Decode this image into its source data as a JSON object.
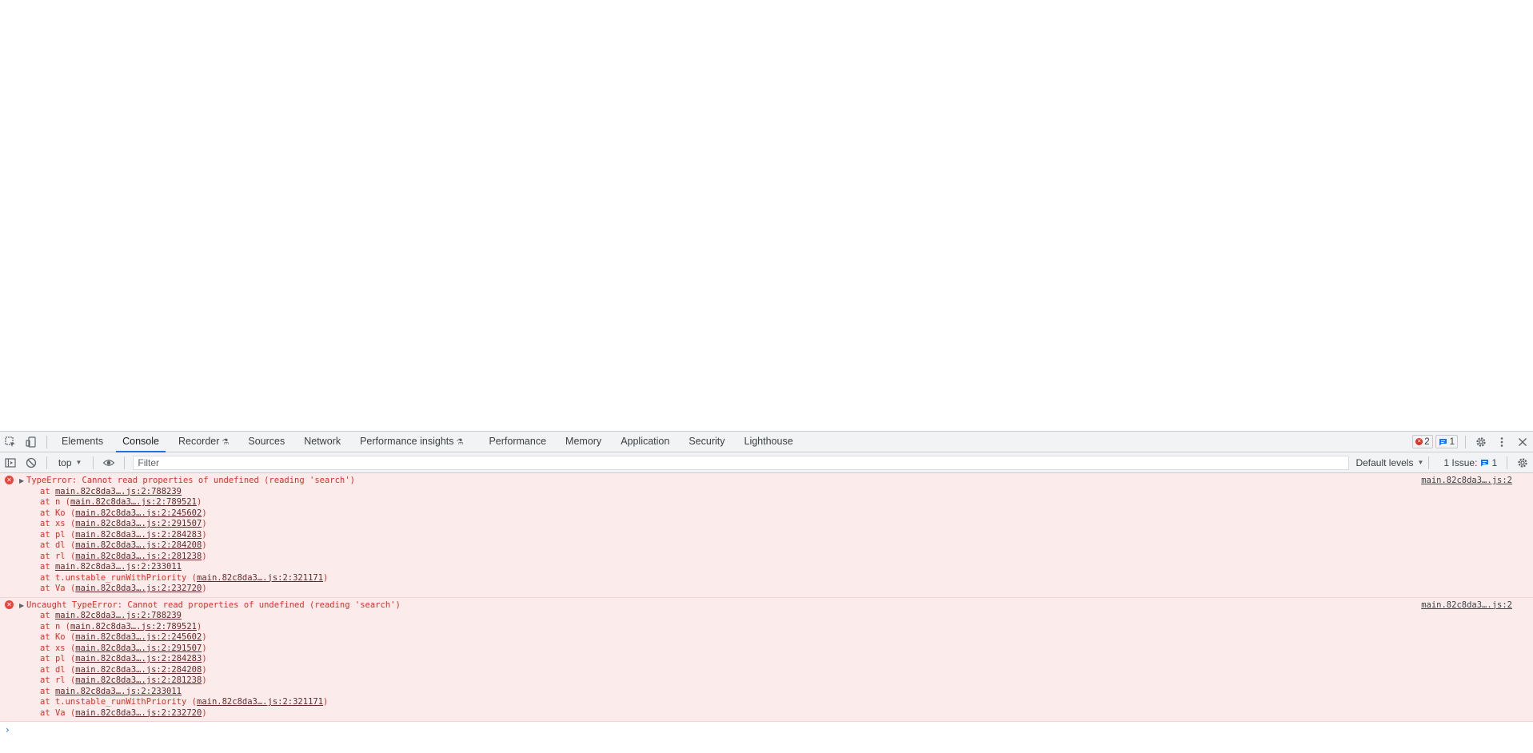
{
  "devtools": {
    "tabs": [
      "Elements",
      "Console",
      "Recorder",
      "Sources",
      "Network",
      "Performance insights",
      "Performance",
      "Memory",
      "Application",
      "Security",
      "Lighthouse"
    ],
    "experimental_tabs": [
      "Recorder",
      "Performance insights"
    ],
    "active_tab": "Console",
    "error_count": "2",
    "message_count": "1"
  },
  "console_toolbar": {
    "context": "top",
    "filter_placeholder": "Filter",
    "levels": "Default levels",
    "issues_label": "1 Issue:",
    "issues_count": "1"
  },
  "messages": [
    {
      "text": "TypeError: Cannot read properties of undefined (reading 'search')",
      "source": "main.82c8da3….js:2",
      "frames": [
        {
          "prefix": "at ",
          "fn": "",
          "loc": "main.82c8da3….js:2:788239"
        },
        {
          "prefix": "at ",
          "fn": "n",
          "loc": "main.82c8da3….js:2:789521"
        },
        {
          "prefix": "at ",
          "fn": "Ko",
          "loc": "main.82c8da3….js:2:245602"
        },
        {
          "prefix": "at ",
          "fn": "xs",
          "loc": "main.82c8da3….js:2:291507"
        },
        {
          "prefix": "at ",
          "fn": "pl",
          "loc": "main.82c8da3….js:2:284283"
        },
        {
          "prefix": "at ",
          "fn": "dl",
          "loc": "main.82c8da3….js:2:284208"
        },
        {
          "prefix": "at ",
          "fn": "rl",
          "loc": "main.82c8da3….js:2:281238"
        },
        {
          "prefix": "at ",
          "fn": "",
          "loc": "main.82c8da3….js:2:233011"
        },
        {
          "prefix": "at ",
          "fn": "t.unstable_runWithPriority",
          "loc": "main.82c8da3….js:2:321171"
        },
        {
          "prefix": "at ",
          "fn": "Va",
          "loc": "main.82c8da3….js:2:232720"
        }
      ]
    },
    {
      "text": "Uncaught TypeError: Cannot read properties of undefined (reading 'search')",
      "source": "main.82c8da3….js:2",
      "frames": [
        {
          "prefix": "at ",
          "fn": "",
          "loc": "main.82c8da3….js:2:788239"
        },
        {
          "prefix": "at ",
          "fn": "n",
          "loc": "main.82c8da3….js:2:789521"
        },
        {
          "prefix": "at ",
          "fn": "Ko",
          "loc": "main.82c8da3….js:2:245602"
        },
        {
          "prefix": "at ",
          "fn": "xs",
          "loc": "main.82c8da3….js:2:291507"
        },
        {
          "prefix": "at ",
          "fn": "pl",
          "loc": "main.82c8da3….js:2:284283"
        },
        {
          "prefix": "at ",
          "fn": "dl",
          "loc": "main.82c8da3….js:2:284208"
        },
        {
          "prefix": "at ",
          "fn": "rl",
          "loc": "main.82c8da3….js:2:281238"
        },
        {
          "prefix": "at ",
          "fn": "",
          "loc": "main.82c8da3….js:2:233011"
        },
        {
          "prefix": "at ",
          "fn": "t.unstable_runWithPriority",
          "loc": "main.82c8da3….js:2:321171"
        },
        {
          "prefix": "at ",
          "fn": "Va",
          "loc": "main.82c8da3….js:2:232720"
        }
      ]
    }
  ],
  "prompt_symbol": "›",
  "colors": {
    "error_text": "#d93025",
    "error_bg": "#fcebeb",
    "accent": "#1a73e8",
    "toolbar_bg": "#f1f3f4"
  },
  "icons": {
    "inspect": "inspect-element-icon",
    "device": "device-toolbar-icon",
    "settings": "gear-icon",
    "more": "more-vertical-icon",
    "close": "close-icon",
    "sidebar": "sidebar-toggle-icon",
    "clear": "clear-console-icon",
    "eye": "eye-icon"
  }
}
